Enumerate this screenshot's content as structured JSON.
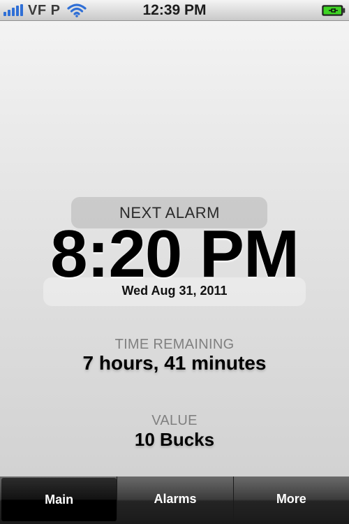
{
  "status_bar": {
    "carrier": "VF P",
    "time": "12:39 PM",
    "signal_icon": "signal-bars-icon",
    "wifi_icon": "wifi-icon",
    "battery_icon": "battery-charging-icon",
    "battery_color": "#3fd424",
    "signal_color": "#2f6fd6"
  },
  "alarm": {
    "label": "NEXT ALARM",
    "time": "8:20 PM",
    "date": "Wed Aug 31, 2011"
  },
  "remaining": {
    "label": "TIME REMAINING",
    "value": "7 hours, 41 minutes"
  },
  "value": {
    "label": "VALUE",
    "amount": "10 Bucks"
  },
  "tabs": [
    {
      "label": "Main",
      "active": true
    },
    {
      "label": "Alarms",
      "active": false
    },
    {
      "label": "More",
      "active": false
    }
  ]
}
